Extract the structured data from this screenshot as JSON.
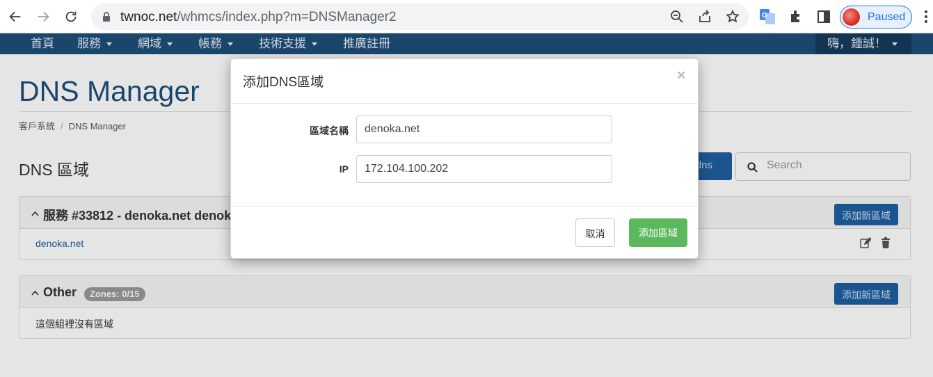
{
  "browser": {
    "url_host": "twnoc.net",
    "url_path": "/whmcs/index.php?m=DNSManager2",
    "profile_status": "Paused"
  },
  "nav": {
    "home": "首頁",
    "services": "服務",
    "domains": "網域",
    "billing": "帳務",
    "support": "技術支援",
    "affiliates": "推廣註冊",
    "greeting": "嗨，鍾誠！"
  },
  "page": {
    "title": "DNS Manager",
    "breadcrumb": [
      "客戶系統",
      "DNS Manager"
    ],
    "section_title": "DNS 區域",
    "action_button_partial": "s_dns",
    "search_placeholder": "Search"
  },
  "panels": [
    {
      "title": "服務 #33812 - denoka.net denok",
      "add_button": "添加新區域",
      "zones": [
        "denoka.net"
      ]
    },
    {
      "title": "Other",
      "badge": "Zones: 0/15",
      "add_button": "添加新區域",
      "empty_text": "這個組裡沒有區域"
    }
  ],
  "modal": {
    "title": "添加DNS區域",
    "close": "×",
    "fields": [
      {
        "label": "區域名稱",
        "value": "denoka.net"
      },
      {
        "label": "IP",
        "value": "172.104.100.202"
      }
    ],
    "cancel_label": "取消",
    "submit_label": "添加區域"
  },
  "colors": {
    "navbar": "#1f4e79",
    "primary_button": "#1f5fa0",
    "success_button": "#5cb85c",
    "link": "#1f5fa0"
  }
}
